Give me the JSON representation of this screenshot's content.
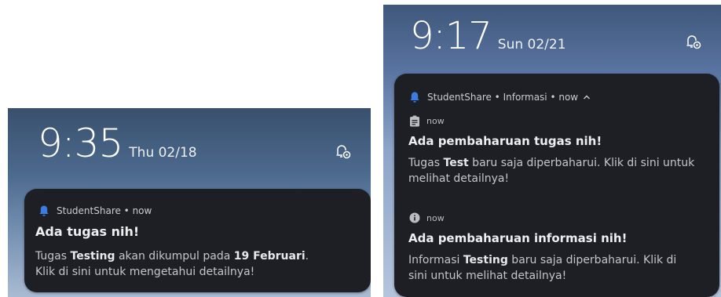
{
  "left": {
    "time": "9:35",
    "date": "Thu 02/18",
    "notification": {
      "app_meta": "StudentShare • now",
      "title": "Ada tugas nih!",
      "body": {
        "p1": "Tugas ",
        "b1": "Testing",
        "p2": " akan dikumpul pada ",
        "b2": "19 Februari",
        "p3": ".",
        "line2": "Klik di sini untuk mengetahui detailnya!"
      }
    }
  },
  "right": {
    "time": "9:17",
    "date": "Sun 02/21",
    "notification": {
      "app_meta": "StudentShare • Informasi • now",
      "items": [
        {
          "icon": "clipboard-icon",
          "time": "now",
          "title": "Ada pembaharuan tugas nih!",
          "body": {
            "p1": "Tugas ",
            "b1": "Test",
            "p2": " baru saja diperbaharui. Klik di sini untuk",
            "line2": "melihat detailnya!"
          }
        },
        {
          "icon": "info-icon",
          "time": "now",
          "title": "Ada pembaharuan informasi nih!",
          "body": {
            "p1": "Informasi ",
            "b1": "Testing",
            "p2": " baru saja diperbaharui. Klik di",
            "line2": "sini untuk melihat detailnya!"
          }
        }
      ]
    }
  },
  "colors": {
    "card_bg": "#1d1f24",
    "bell_blue": "#3d7be0",
    "title_text": "#eceef2",
    "body_text": "#c3c6cc"
  }
}
